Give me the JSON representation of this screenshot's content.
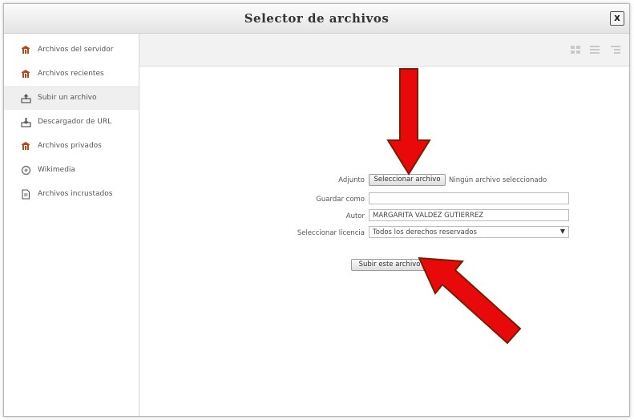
{
  "dialog": {
    "title": "Selector de archivos",
    "close_label": "x"
  },
  "sidebar": {
    "items": [
      {
        "label": "Archivos del servidor",
        "icon": "repository-icon"
      },
      {
        "label": "Archivos recientes",
        "icon": "repository-icon"
      },
      {
        "label": "Subir un archivo",
        "icon": "upload-icon",
        "active": true
      },
      {
        "label": "Descargador de URL",
        "icon": "download-icon"
      },
      {
        "label": "Archivos privados",
        "icon": "repository-icon"
      },
      {
        "label": "Wikimedia",
        "icon": "wikimedia-icon"
      },
      {
        "label": "Archivos incrustados",
        "icon": "document-icon"
      }
    ]
  },
  "toolbar": {
    "views": [
      "icon-view-icon",
      "list-view-icon",
      "tree-view-icon"
    ]
  },
  "form": {
    "attachment_label": "Adjunto",
    "choose_button": "Seleccionar archivo",
    "no_file_text": "Ningún archivo seleccionado",
    "save_as_label": "Guardar como",
    "save_as_value": "",
    "author_label": "Autor",
    "author_value": "MARGARITA VALDEZ GUTIERREZ",
    "license_label": "Seleccionar licencia",
    "license_value": "Todos los derechos reservados",
    "upload_button": "Subir este archivo"
  },
  "colors": {
    "arrow_fill": "#e8090a",
    "arrow_stroke": "#7a1c00",
    "repo_icon": "#b5471a"
  }
}
